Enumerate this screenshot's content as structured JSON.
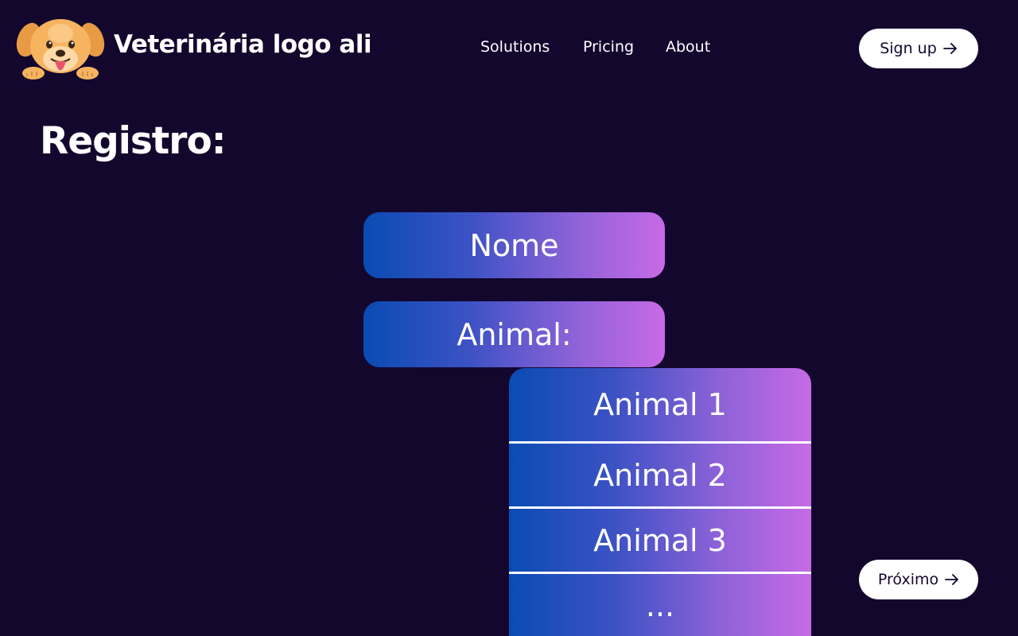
{
  "header": {
    "brand_name": "Veterinária logo ali",
    "logo_icon": "dog-logo-icon",
    "nav": [
      {
        "label": "Solutions"
      },
      {
        "label": "Pricing"
      },
      {
        "label": "About"
      }
    ],
    "signup_label": "Sign up",
    "signup_icon": "arrow-right-icon"
  },
  "main": {
    "title": "Registro:",
    "name_field_label": "Nome",
    "animal_field_label": "Animal:",
    "animal_options": [
      {
        "label": "Animal 1"
      },
      {
        "label": "Animal 2"
      },
      {
        "label": "Animal 3"
      },
      {
        "label": "..."
      }
    ],
    "next_label": "Próximo",
    "next_icon": "arrow-right-icon"
  },
  "colors": {
    "background": "#13072e",
    "gradient_start": "#0a4bb3",
    "gradient_end": "#c76ae6",
    "button_bg": "#ffffff",
    "logo_fur": "#f6b461"
  }
}
